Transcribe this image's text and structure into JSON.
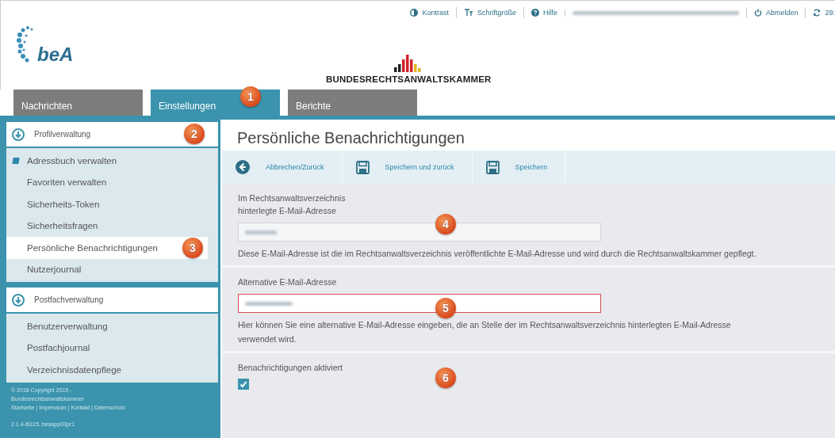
{
  "top_links": [
    {
      "label": "Kontrast",
      "kind": "contrast"
    },
    {
      "label": "Schriftgröße",
      "kind": "font"
    },
    {
      "label": "Hilfe",
      "kind": "help"
    },
    {
      "label": "Abmelden",
      "kind": "power"
    },
    {
      "label": "29:",
      "kind": "refresh"
    }
  ],
  "logo": {
    "name": "beA"
  },
  "organization": "BUNDESRECHTSANWALTSKAMMER",
  "tabs": [
    {
      "label": "Nachrichten",
      "selected": false
    },
    {
      "label": "Einstellungen",
      "selected": true,
      "callout": "1"
    },
    {
      "label": "Berichte",
      "selected": false
    }
  ],
  "sidebar": {
    "sections": [
      {
        "title": "Profilverwaltung",
        "callout": "2",
        "items": [
          {
            "label": "Adressbuch verwalten",
            "selected": false,
            "marked": true
          },
          {
            "label": "Favoriten verwalten",
            "selected": false,
            "marked": false
          },
          {
            "label": "Sicherheits-Token",
            "selected": false,
            "marked": false
          },
          {
            "label": "Sicherheitsfragen",
            "selected": false,
            "marked": false
          },
          {
            "label": "Persönliche Benachrichtigungen",
            "selected": true,
            "marked": false,
            "callout": "3"
          },
          {
            "label": "Nutzerjournal",
            "selected": false,
            "marked": false
          }
        ]
      },
      {
        "title": "Postfachverwaltung",
        "items": [
          {
            "label": "Benutzerverwaltung",
            "selected": false,
            "marked": false
          },
          {
            "label": "Postfachjournal",
            "selected": false,
            "marked": false
          },
          {
            "label": "Verzeichnisdatenpflege",
            "selected": false,
            "marked": false
          }
        ]
      }
    ],
    "footer": {
      "lines": [
        "© 2018 Copyright 2015 -",
        "Bundesrechtsanwaltskammer"
      ],
      "links": "Startseite | Impressum | Kontakt | Datenschutz",
      "version": "2.1.4-t6115, beaapp03pr1"
    }
  },
  "page_title": "Persönliche Benachrichtigungen",
  "toolbar": [
    {
      "label": "Abbrechen/Zurück",
      "kind": "back"
    },
    {
      "label": "Speichern und zurück",
      "kind": "save"
    },
    {
      "label": "Speichern",
      "kind": "save"
    }
  ],
  "form": [
    {
      "kind": "field",
      "label": "Im Rechtsanwaltsverzeichnis\nhinterlegte E-Mail-Adresse",
      "readonly": true,
      "invalid": false,
      "callout": "4",
      "help": "Diese E-Mail-Adresse ist die im Rechtsanwaltsverzeichnis veröffentlichte E-Mail-Adresse und wird durch die Rechtsanwaltskammer gepflegt."
    },
    {
      "kind": "field",
      "label": "Alternative E-Mail-Adresse",
      "readonly": false,
      "invalid": true,
      "callout": "5",
      "help": "Hier können Sie eine alternative E-Mail-Adresse eingeben, die an Stelle der im Rechtsanwaltsverzeichnis hinterlegten E-Mail-Adresse verwendet wird."
    },
    {
      "kind": "checkbox",
      "label": "Benachrichtigungen aktiviert",
      "checked": true,
      "callout": "6"
    }
  ]
}
